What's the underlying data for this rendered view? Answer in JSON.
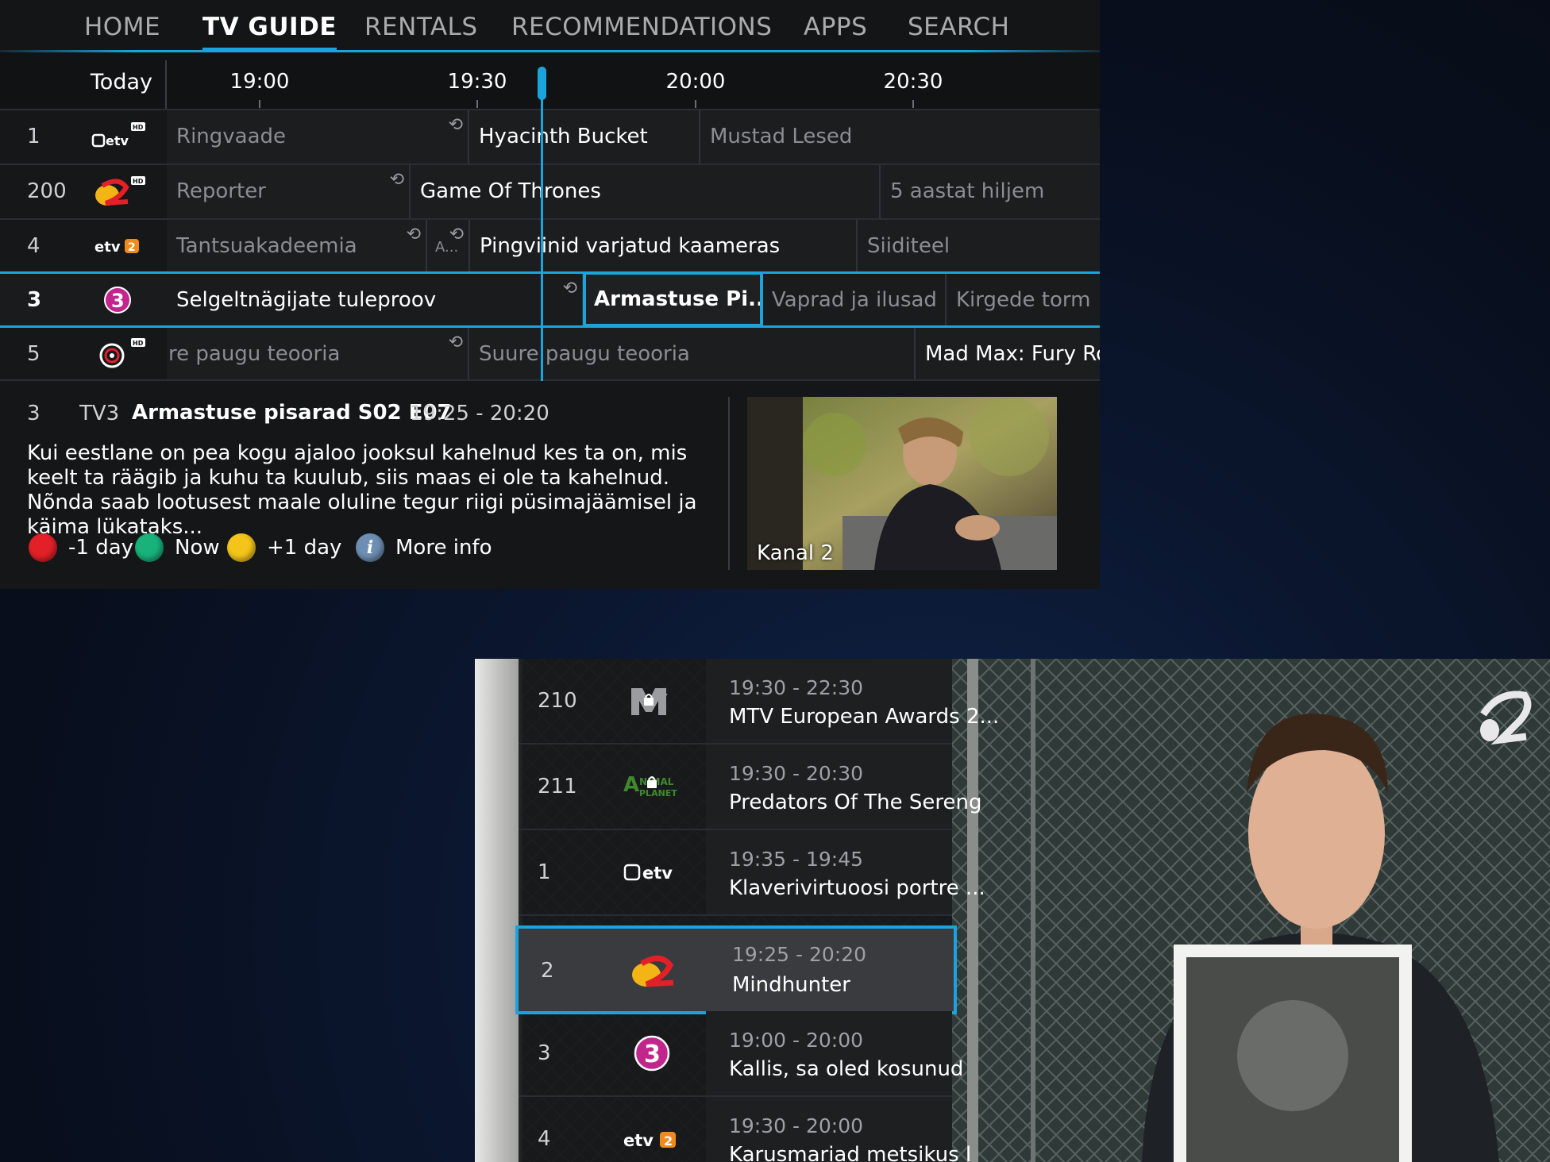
{
  "nav": {
    "items": [
      "HOME",
      "TV GUIDE",
      "RENTALS",
      "RECOMMENDATIONS",
      "APPS",
      "SEARCH"
    ],
    "active": "TV GUIDE"
  },
  "timebar": {
    "today": "Today",
    "ticks": [
      "19:00",
      "19:30",
      "20:00",
      "20:30"
    ]
  },
  "channels": [
    {
      "num": "1",
      "logo": "etv-hd-logo",
      "programs": [
        {
          "title": "Ringvaade",
          "past": true,
          "rec": true
        },
        {
          "title": "Hyacinth Bucket",
          "past": false
        },
        {
          "title": "Mustad Lesed",
          "past": true
        }
      ]
    },
    {
      "num": "200",
      "logo": "kanal2-hd-logo",
      "programs": [
        {
          "title": "Reporter",
          "past": true,
          "rec": true
        },
        {
          "title": "Game Of Thrones",
          "past": false
        },
        {
          "title": "5 aastat hiljem",
          "past": true
        }
      ]
    },
    {
      "num": "4",
      "logo": "etv2-logo",
      "programs": [
        {
          "title": "Tantsuakadeemia",
          "past": true,
          "rec": true
        },
        {
          "title": "A...",
          "past": true,
          "rec": true
        },
        {
          "title": "Pingviinid varjatud kaameras",
          "past": false
        },
        {
          "title": "Siiditeel",
          "past": true
        }
      ]
    },
    {
      "num": "3",
      "logo": "tv3-logo",
      "selected": true,
      "programs": [
        {
          "title": "Selgeltnägijate tuleproov",
          "past": false,
          "rec": true
        },
        {
          "title": "Armastuse Pi...",
          "focus": true
        },
        {
          "title": "Vaprad ja ilusad",
          "past": true
        },
        {
          "title": "Kirgede torm",
          "past": true
        }
      ]
    },
    {
      "num": "5",
      "logo": "tv6-hd-logo",
      "programs": [
        {
          "title": "re paugu teooria",
          "past": true,
          "rec": true
        },
        {
          "title": "Suure paugu teooria",
          "past": true
        },
        {
          "title": "Mad Max: Fury Road",
          "past": false
        }
      ]
    }
  ],
  "info": {
    "num": "3",
    "channel": "TV3",
    "title": "Armastuse pisarad S02 E07",
    "time": "19:25 - 20:20",
    "description": "Kui eestlane on pea kogu ajaloo jooksul kahelnud kes ta on, mis keelt ta räägib ja kuhu ta kuulub, siis maas ei ole ta kahelnud. Nõnda saab lootusest maale oluline tegur riigi püsimajäämisel ja käima lükataks...",
    "buttons": [
      {
        "label": "-1 day",
        "color": "#e32028"
      },
      {
        "label": "Now",
        "color": "#18b27a"
      },
      {
        "label": "+1 day",
        "color": "#f3c41a"
      },
      {
        "label": "More info",
        "color": "#6e8fb3",
        "icon": "info-icon"
      }
    ],
    "preview_label": "Kanal 2"
  },
  "mini": {
    "items": [
      {
        "num": "210",
        "logo": "mtv-logo",
        "locked": true,
        "time": "19:30 - 22:30",
        "title": "MTV European Awards 2..."
      },
      {
        "num": "211",
        "logo": "animal-planet-logo",
        "locked": true,
        "time": "19:30 - 20:30",
        "title": "Predators Of The Sereng"
      },
      {
        "num": "1",
        "logo": "etv-logo",
        "time": "19:35 - 19:45",
        "title": "Klaverivirtuoosi portre ..."
      },
      {
        "num": "2",
        "logo": "kanal2-logo",
        "time": "19:25 - 20:20",
        "title": "Mindhunter",
        "focus": true
      },
      {
        "num": "3",
        "logo": "tv3-logo",
        "time": "19:00 - 20:00",
        "title": "Kallis, sa oled kosunud"
      },
      {
        "num": "4",
        "logo": "etv2-logo",
        "time": "19:30 - 20:00",
        "title": "Karusmariad metsikus l"
      }
    ]
  },
  "colors": {
    "accent": "#1ba3dc",
    "panel": "#111214"
  }
}
